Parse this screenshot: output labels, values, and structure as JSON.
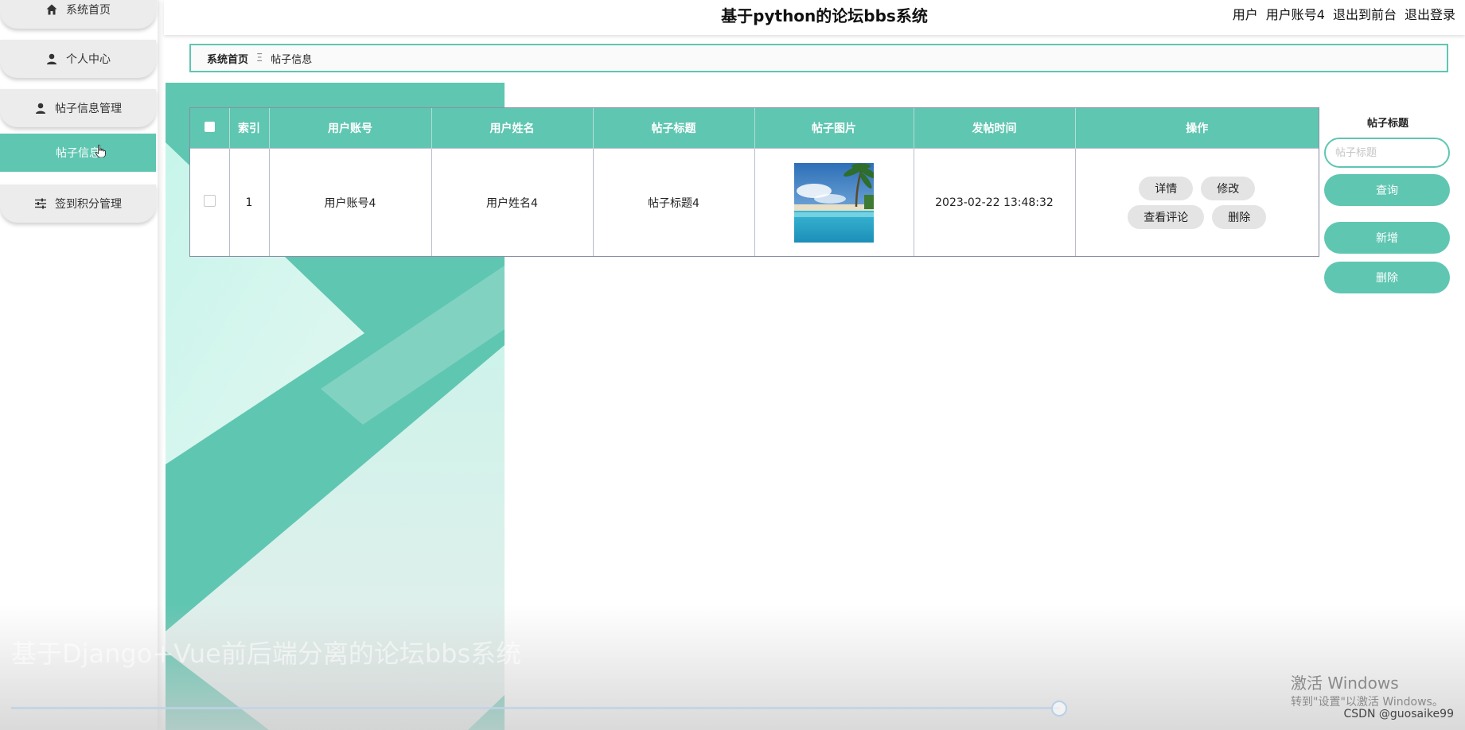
{
  "sidebar": {
    "items": [
      {
        "label": "系统首页",
        "icon": "home-icon"
      },
      {
        "label": "个人中心",
        "icon": "user-icon"
      },
      {
        "label": "帖子信息管理",
        "icon": "user-icon"
      },
      {
        "label": "帖子信息",
        "icon": "",
        "active": true
      },
      {
        "label": "签到积分管理",
        "icon": "sliders-icon"
      }
    ]
  },
  "header": {
    "title": "基于python的论坛bbs系统",
    "user_role": "用户",
    "username": "用户账号4",
    "to_front": "退出到前台",
    "logout": "退出登录"
  },
  "breadcrumb": {
    "home": "系统首页",
    "separator": "Ξ",
    "current": "帖子信息"
  },
  "table": {
    "columns": [
      "索引",
      "用户账号",
      "用户姓名",
      "帖子标题",
      "帖子图片",
      "发帖时间",
      "操作"
    ],
    "rows": [
      {
        "index": "1",
        "account": "用户账号4",
        "name": "用户姓名4",
        "title": "帖子标题4",
        "image": "beach-palm-image",
        "time": "2023-02-22 13:48:32"
      }
    ],
    "actions": {
      "detail": "详情",
      "edit": "修改",
      "comments": "查看评论",
      "delete": "删除"
    }
  },
  "search": {
    "label": "帖子标题",
    "placeholder": "帖子标题",
    "query_button": "查询",
    "add_button": "新增",
    "delete_button": "删除"
  },
  "overlay": {
    "video_title": "基于Django+Vue前后端分离的论坛bbs系统",
    "win_line1": "激活 Windows",
    "win_line2": "转到\"设置\"以激活 Windows。",
    "watermark": "CSDN @guosaike99"
  },
  "colors": {
    "accent": "#5fc6b1",
    "sidebar_item": "#ececec"
  }
}
